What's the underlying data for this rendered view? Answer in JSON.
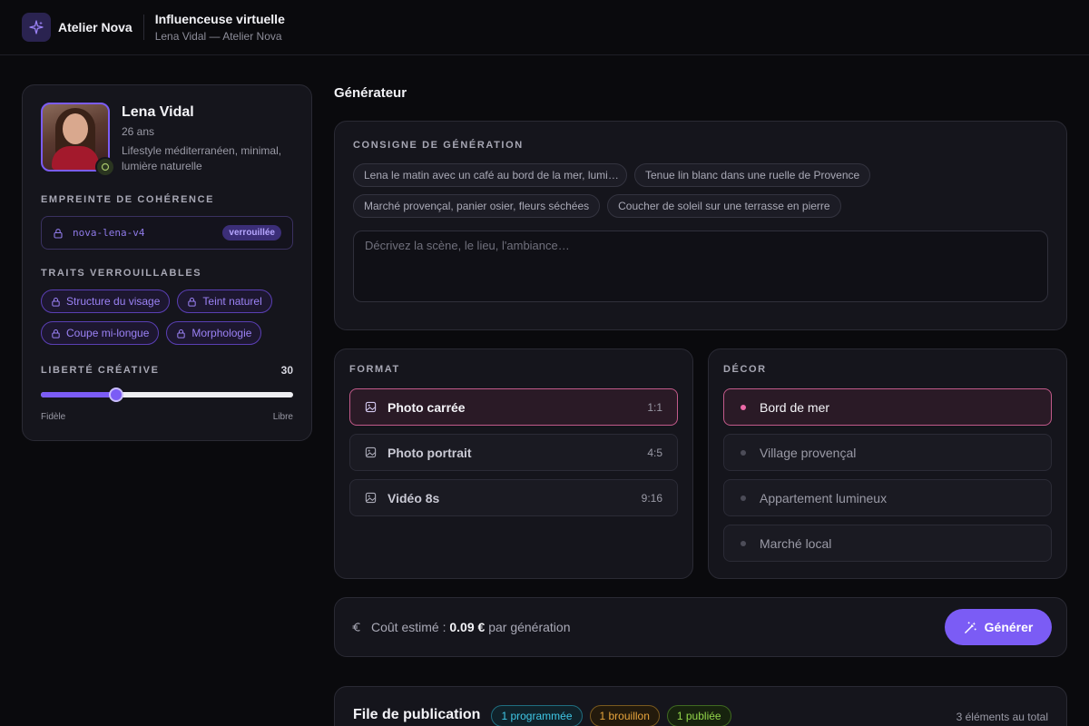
{
  "header": {
    "brand": "Atelier Nova",
    "title": "Influenceuse virtuelle",
    "subtitle": "Lena Vidal — Atelier Nova"
  },
  "persona": {
    "name": "Lena Vidal",
    "age": "26 ans",
    "description": "Lifestyle méditerranéen, minimal, lumière naturelle",
    "fingerprint_label": "EMPREINTE DE COHÉRENCE",
    "fingerprint_code": "nova-lena-v4",
    "fingerprint_status": "verrouillée",
    "traits_label": "TRAITS VERROUILLABLES",
    "traits": [
      "Structure du visage",
      "Teint naturel",
      "Coupe mi-longue",
      "Morphologie"
    ],
    "freedom_label": "LIBERTÉ CRÉATIVE",
    "freedom_value": "30",
    "freedom_level": 0.3,
    "freedom_min_label": "Fidèle",
    "freedom_max_label": "Libre"
  },
  "generator": {
    "title": "Générateur",
    "prompt_label": "CONSIGNE DE GÉNÉRATION",
    "suggestions": [
      "Lena le matin avec un café au bord de la mer, lumi…",
      "Tenue lin blanc dans une ruelle de Provence",
      "Marché provençal, panier osier, fleurs séchées",
      "Coucher de soleil sur une terrasse en pierre"
    ],
    "prompt_value": "",
    "prompt_placeholder": "Décrivez la scène, le lieu, l'ambiance…",
    "format_label": "FORMAT",
    "formats": [
      {
        "label": "Photo carrée",
        "ratio": "1:1",
        "selected": true
      },
      {
        "label": "Photo portrait",
        "ratio": "4:5",
        "selected": false
      },
      {
        "label": "Vidéo 8s",
        "ratio": "9:16",
        "selected": false
      }
    ],
    "decor_label": "DÉCOR",
    "decors": [
      {
        "label": "Bord de mer",
        "selected": true
      },
      {
        "label": "Village provençal",
        "selected": false
      },
      {
        "label": "Appartement lumineux",
        "selected": false
      },
      {
        "label": "Marché local",
        "selected": false
      }
    ],
    "cost_prefix": "Coût estimé : ",
    "cost_value": "0.09 €",
    "cost_suffix": " par génération",
    "generate_label": "Générer"
  },
  "queue": {
    "title": "File de publication",
    "badges": {
      "scheduled": "1 programmée",
      "draft": "1 brouillon",
      "published": "1 publiée"
    },
    "total": "3 éléments au total"
  },
  "colors": {
    "accent": "#7b5cf5",
    "selected_border": "#c25a8a",
    "background": "#0a0a0d",
    "panel": "#15151c"
  },
  "icons": {
    "brand": "sparkles-icon",
    "lock": "lock-icon",
    "image": "image-icon",
    "euro": "euro-icon",
    "wand": "magic-wand-icon"
  }
}
